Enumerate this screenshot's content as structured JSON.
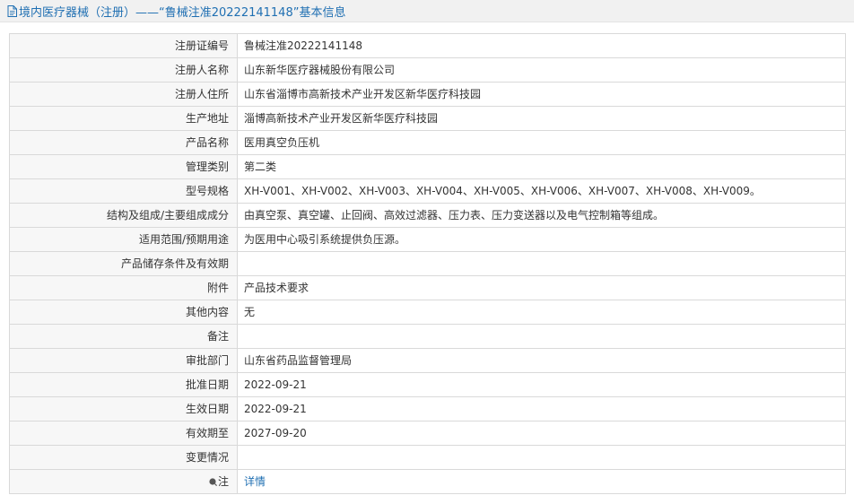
{
  "header": {
    "title": "境内医疗器械（注册）——“鲁械注准20222141148”基本信息",
    "icon": "document-icon"
  },
  "colors": {
    "link": "#1f6fb2",
    "label_bg": "#f7f7f7",
    "border": "#d9d9d9",
    "title_bg": "#f1f1f1"
  },
  "rows": [
    {
      "label": "注册证编号",
      "value": "鲁械注准20222141148"
    },
    {
      "label": "注册人名称",
      "value": "山东新华医疗器械股份有限公司"
    },
    {
      "label": "注册人住所",
      "value": "山东省淄博市高新技术产业开发区新华医疗科技园"
    },
    {
      "label": "生产地址",
      "value": "淄博高新技术产业开发区新华医疗科技园"
    },
    {
      "label": "产品名称",
      "value": "医用真空负压机"
    },
    {
      "label": "管理类别",
      "value": "第二类"
    },
    {
      "label": "型号规格",
      "value": "XH-V001、XH-V002、XH-V003、XH-V004、XH-V005、XH-V006、XH-V007、XH-V008、XH-V009。"
    },
    {
      "label": "结构及组成/主要组成成分",
      "value": "由真空泵、真空罐、止回阀、高效过滤器、压力表、压力变送器以及电气控制箱等组成。"
    },
    {
      "label": "适用范围/预期用途",
      "value": "为医用中心吸引系统提供负压源。"
    },
    {
      "label": "产品储存条件及有效期",
      "value": ""
    },
    {
      "label": "附件",
      "value": "产品技术要求"
    },
    {
      "label": "其他内容",
      "value": "无"
    },
    {
      "label": "备注",
      "value": ""
    },
    {
      "label": "审批部门",
      "value": "山东省药品监督管理局"
    },
    {
      "label": "批准日期",
      "value": "2022-09-21"
    },
    {
      "label": "生效日期",
      "value": "2022-09-21"
    },
    {
      "label": "有效期至",
      "value": "2027-09-20"
    },
    {
      "label": "变更情况",
      "value": ""
    }
  ],
  "note_row": {
    "label": "注",
    "icon": "bullet-note-icon",
    "link_text": "详情"
  }
}
